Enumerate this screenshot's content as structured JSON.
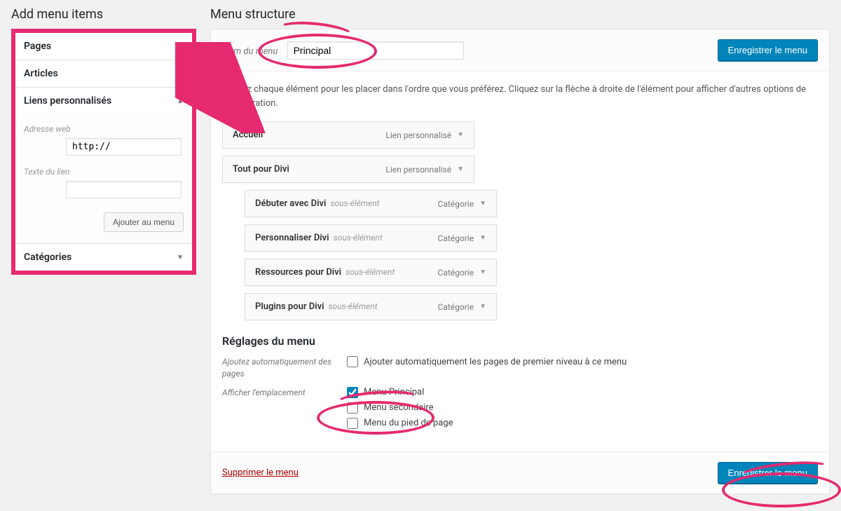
{
  "left": {
    "title": "Add menu items",
    "sections": [
      {
        "label": "Pages",
        "expanded": false
      },
      {
        "label": "Articles",
        "expanded": false
      },
      {
        "label": "Liens personnalisés",
        "expanded": true
      },
      {
        "label": "Catégories",
        "expanded": false
      }
    ],
    "custom_link": {
      "url_label": "Adresse web",
      "url_value": "http://",
      "text_label": "Texte du lien",
      "text_value": "",
      "add_button": "Ajouter au menu"
    }
  },
  "right": {
    "title": "Menu structure",
    "menu_name_label": "Nom du menu",
    "menu_name_value": "Principal",
    "save_button": "Enregistrer le menu",
    "instructions": "Glissez chaque élément pour les placer dans l'ordre que vous préférez. Cliquez sur la flèche à droite de l'élément pour afficher d'autres options de configuration.",
    "items": [
      {
        "title": "Accueil",
        "type": "Lien personnalisé",
        "depth": 0,
        "sub": ""
      },
      {
        "title": "Tout pour Divi",
        "type": "Lien personnalisé",
        "depth": 0,
        "sub": ""
      },
      {
        "title": "Débuter avec Divi",
        "type": "Catégorie",
        "depth": 1,
        "sub": "sous-élément"
      },
      {
        "title": "Personnaliser Divi",
        "type": "Catégorie",
        "depth": 1,
        "sub": "sous-élément"
      },
      {
        "title": "Ressources pour Divi",
        "type": "Catégorie",
        "depth": 1,
        "sub": "sous-élément"
      },
      {
        "title": "Plugins pour Divi",
        "type": "Catégorie",
        "depth": 1,
        "sub": "sous-élément"
      }
    ],
    "settings": {
      "heading": "Réglages du menu",
      "auto_add_label": "Ajoutez automatiquement des pages",
      "auto_add_text": "Ajouter automatiquement les pages de premier niveau à ce menu",
      "location_label": "Afficher l'emplacement",
      "locations": [
        {
          "label": "Menu Principal",
          "checked": true
        },
        {
          "label": "Menu secondaire",
          "checked": false
        },
        {
          "label": "Menu du pied de page",
          "checked": false
        }
      ]
    },
    "delete_link": "Supprimer le menu"
  }
}
